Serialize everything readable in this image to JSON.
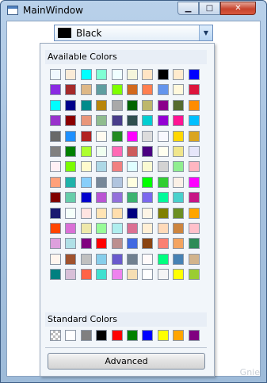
{
  "window": {
    "title": "MainWindow",
    "minimize": "▁",
    "maximize": "□",
    "close": "✕"
  },
  "combo": {
    "selected_label": "Black",
    "selected_color": "#000000"
  },
  "available": {
    "header": "Available Colors",
    "colors": [
      "#f0f8ff",
      "#faebd7",
      "#00ffff",
      "#7fffd4",
      "#f0ffff",
      "#f5f5dc",
      "#ffe4c4",
      "#000000",
      "#ffebcd",
      "#0000ff",
      "#8a2be2",
      "#a52a2a",
      "#deb887",
      "#5f9ea0",
      "#7fff00",
      "#d2691e",
      "#ff7f50",
      "#6495ed",
      "#fff8dc",
      "#dc143c",
      "#00ffff",
      "#00008b",
      "#008b8b",
      "#b8860b",
      "#a9a9a9",
      "#006400",
      "#bdb76b",
      "#8b008b",
      "#556b2f",
      "#ff8c00",
      "#9932cc",
      "#8b0000",
      "#e9967a",
      "#8fbc8f",
      "#483d8b",
      "#2f4f4f",
      "#00ced1",
      "#9400d3",
      "#ff1493",
      "#00bfff",
      "#696969",
      "#1e90ff",
      "#b22222",
      "#fffaf0",
      "#228b22",
      "#ff00ff",
      "#dcdcdc",
      "#f8f8ff",
      "#ffd700",
      "#daa520",
      "#808080",
      "#008000",
      "#adff2f",
      "#f0fff0",
      "#ff69b4",
      "#cd5c5c",
      "#4b0082",
      "#fffff0",
      "#f0e68c",
      "#e6e6fa",
      "#fff0f5",
      "#7cfc00",
      "#fffacd",
      "#add8e6",
      "#f08080",
      "#e0ffff",
      "#fafad2",
      "#d3d3d3",
      "#90ee90",
      "#ffb6c1",
      "#ffa07a",
      "#20b2aa",
      "#87cefa",
      "#778899",
      "#b0c4de",
      "#ffffe0",
      "#00ff00",
      "#32cd32",
      "#faf0e6",
      "#ff00ff",
      "#800000",
      "#66cdaa",
      "#0000cd",
      "#ba55d3",
      "#9370db",
      "#3cb371",
      "#7b68ee",
      "#00fa9a",
      "#48d1cc",
      "#c71585",
      "#191970",
      "#f5fffa",
      "#ffe4e1",
      "#ffe4b5",
      "#ffdead",
      "#000080",
      "#fdf5e6",
      "#808000",
      "#6b8e23",
      "#ffa500",
      "#ff4500",
      "#da70d6",
      "#eee8aa",
      "#98fb98",
      "#afeeee",
      "#db7093",
      "#ffefd5",
      "#ffdab9",
      "#cd853f",
      "#ffc0cb",
      "#dda0dd",
      "#b0e0e6",
      "#800080",
      "#ff0000",
      "#bc8f8f",
      "#4169e1",
      "#8b4513",
      "#fa8072",
      "#f4a460",
      "#2e8b57",
      "#fff5ee",
      "#a0522d",
      "#c0c0c0",
      "#87ceeb",
      "#6a5acd",
      "#708090",
      "#fffafa",
      "#00ff7f",
      "#4682b4",
      "#d2b48c",
      "#008080",
      "#d8bfd8",
      "#ff6347",
      "#40e0d0",
      "#ee82ee",
      "#f5deb3",
      "#ffffff",
      "#f5f5f5",
      "#ffff00",
      "#9acd32"
    ]
  },
  "standard": {
    "header": "Standard Colors",
    "colors": [
      "transparent",
      "#ffffff",
      "#808080",
      "#000000",
      "#ff0000",
      "#008000",
      "#0000ff",
      "#ffff00",
      "#ffa500",
      "#800080"
    ]
  },
  "advanced_label": "Advanced",
  "watermark": "Gnie"
}
